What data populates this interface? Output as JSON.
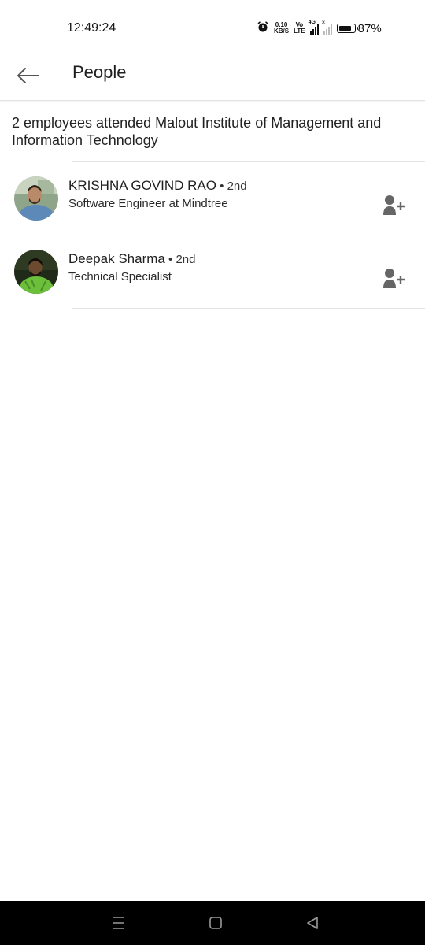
{
  "status_bar": {
    "time": "12:49:24",
    "net_speed_top": "0.10",
    "net_speed_bottom": "KB/S",
    "volte_top": "Vo",
    "volte_bottom": "LTE",
    "network": "4G",
    "battery_percent": "87%",
    "battery_level": 0.87
  },
  "header": {
    "back_icon": "arrow-left-icon",
    "title": "People"
  },
  "summary": "2 employees attended Malout Institute of Management and Information Technology",
  "people": [
    {
      "name": "KRISHNA GOVIND RAO",
      "separator": " • ",
      "degree": "2nd",
      "headline": "Software Engineer at Mindtree",
      "action_icon": "add-person-icon"
    },
    {
      "name": "Deepak Sharma",
      "separator": " • ",
      "degree": "2nd",
      "headline": "Technical Specialist",
      "action_icon": "add-person-icon"
    }
  ],
  "nav_bar": {
    "recents_icon": "menu-lines-icon",
    "home_icon": "square-icon",
    "back_icon": "triangle-back-icon"
  },
  "colors": {
    "icon_gray": "#666666",
    "divider": "#e4e4e4",
    "navbar": "#000000"
  }
}
